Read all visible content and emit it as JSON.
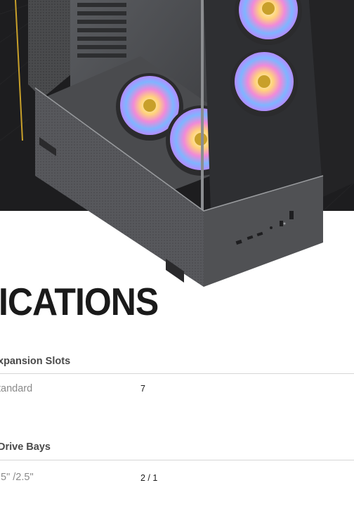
{
  "specifications": {
    "title": "ICATIONS",
    "groups": [
      {
        "title": "xpansion Slots",
        "rows": [
          {
            "label": "tandard",
            "value": "7"
          }
        ]
      },
      {
        "title": "Drive Bays",
        "rows": [
          {
            "label": ".5\" /2.5\"",
            "value": "2 / 1"
          }
        ]
      }
    ]
  },
  "hero": {
    "background_color": "#1d1d1f",
    "accent_line_color": "#c8a02a",
    "icons": [
      "rgb-fan-icon",
      "fan-hub-logo-icon",
      "usb-port-icon",
      "power-button-icon"
    ]
  }
}
